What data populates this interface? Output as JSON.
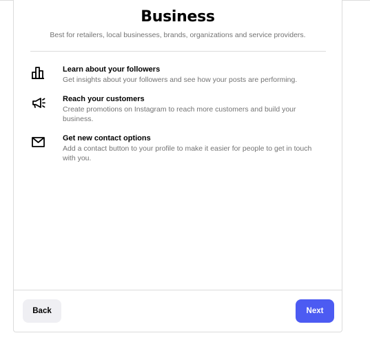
{
  "header": {
    "title": "Business",
    "subtitle": "Best for retailers, local businesses, brands, organizations and service providers."
  },
  "features": [
    {
      "icon": "bar-chart-icon",
      "title": "Learn about your followers",
      "description": "Get insights about your followers and see how your posts are performing."
    },
    {
      "icon": "megaphone-icon",
      "title": "Reach your customers",
      "description": "Create promotions on Instagram to reach more customers and build your business."
    },
    {
      "icon": "envelope-icon",
      "title": "Get new contact options",
      "description": "Add a contact button to your profile to make it easier for people to get in touch with you."
    }
  ],
  "footer": {
    "back_label": "Back",
    "next_label": "Next"
  },
  "colors": {
    "primary_button": "#4c5bf2",
    "secondary_button": "#efeff3",
    "border": "#dbdbdb",
    "muted_text": "#737373"
  }
}
